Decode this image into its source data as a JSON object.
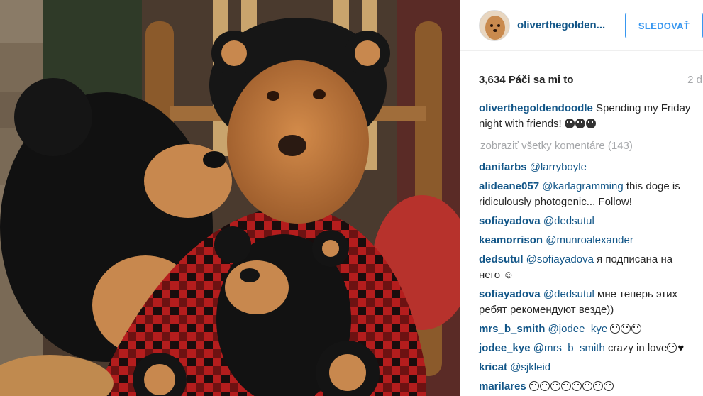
{
  "post": {
    "username": "oliverthegolden...",
    "follow_label": "SLEDOVAŤ",
    "likes": "3,634 Páči sa mi to",
    "age": "2 d"
  },
  "caption": {
    "user": "oliverthegoldendoodle",
    "text": "Spending my Friday night with friends!"
  },
  "view_all": "zobraziť všetky komentáre (143)",
  "comments": [
    {
      "user": "danifarbs",
      "mention": "@larryboyle",
      "text": ""
    },
    {
      "user": "alideane057",
      "mention": "@karlagramming",
      "text": "this doge is ridiculously photogenic... Follow!"
    },
    {
      "user": "sofiayadova",
      "mention": "@dedsutul",
      "text": ""
    },
    {
      "user": "keamorrison",
      "mention": "@munroalexander",
      "text": ""
    },
    {
      "user": "dedsutul",
      "mention": "@sofiayadova",
      "text": "я подписана на него ☺"
    },
    {
      "user": "sofiayadova",
      "mention": "@dedsutul",
      "text": "мне теперь этих ребят рекомендуют везде))"
    },
    {
      "user": "mrs_b_smith",
      "mention": "@jodee_kye",
      "text": ""
    },
    {
      "user": "jodee_kye",
      "mention": "@mrs_b_smith",
      "text": "crazy in love"
    },
    {
      "user": "kricat",
      "mention": "@sjkleid",
      "text": ""
    },
    {
      "user": "marilares",
      "mention": "",
      "text": ""
    }
  ],
  "colors": {
    "link": "#125688",
    "follow": "#3897f0",
    "muted": "#a5a7aa"
  }
}
